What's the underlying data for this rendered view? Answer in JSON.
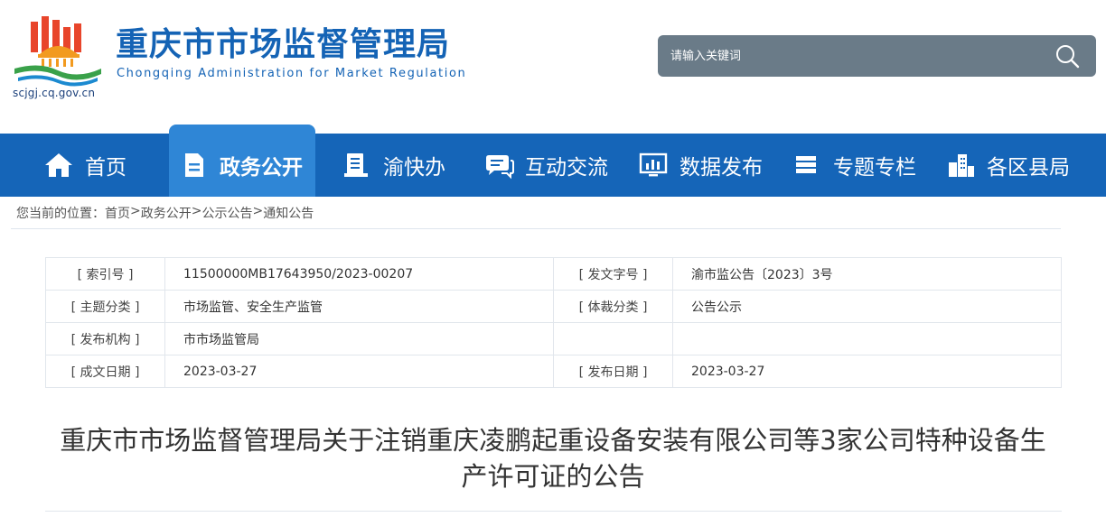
{
  "header": {
    "title": "重庆市市场监督管理局",
    "subtitle": "Chongqing  Administration for Market Regulation",
    "domain": "scjgj.cq.gov.cn",
    "colors": {
      "brand": "#1463b5",
      "emblem_red": "#e8452b",
      "emblem_orange": "#f29a1f",
      "emblem_green": "#3aa14a"
    }
  },
  "search": {
    "placeholder": "请输入关键词",
    "icon": "search-icon"
  },
  "nav": {
    "items": [
      {
        "label": "首页",
        "icon": "home-icon"
      },
      {
        "label": "政务公开",
        "icon": "document-icon",
        "active": true
      },
      {
        "label": "渝快办",
        "icon": "service-icon"
      },
      {
        "label": "互动交流",
        "icon": "chat-icon"
      },
      {
        "label": "数据发布",
        "icon": "monitor-chart-icon"
      },
      {
        "label": "专题专栏",
        "icon": "layers-icon"
      },
      {
        "label": "各区县局",
        "icon": "buildings-icon"
      }
    ],
    "colors": {
      "bar": "#1565b8",
      "active": "#2f86d6"
    }
  },
  "breadcrumb": {
    "prefix": "您当前的位置：",
    "items": [
      "首页",
      "政务公开",
      "公示公告",
      "通知公告"
    ],
    "separator": ">"
  },
  "meta": {
    "rows": [
      {
        "label1": "[ 索引号 ]",
        "value1": "11500000MB17643950/2023-00207",
        "label2": "[ 发文字号 ]",
        "value2": "渝市监公告〔2023〕3号"
      },
      {
        "label1": "[ 主题分类 ]",
        "value1": "市场监管、安全生产监管",
        "label2": "[ 体裁分类 ]",
        "value2": "公告公示"
      },
      {
        "label1": "[ 发布机构 ]",
        "value1": "市市场监管局",
        "label2": "",
        "value2": ""
      },
      {
        "label1": "[ 成文日期 ]",
        "value1": "2023-03-27",
        "label2": "[ 发布日期 ]",
        "value2": "2023-03-27"
      }
    ]
  },
  "document": {
    "title_line1": "重庆市市场监督管理局关于注销重庆凌鹏起重设备安装有限公司等3家公司特种设备生",
    "title_line2": "产许可证的公告"
  }
}
